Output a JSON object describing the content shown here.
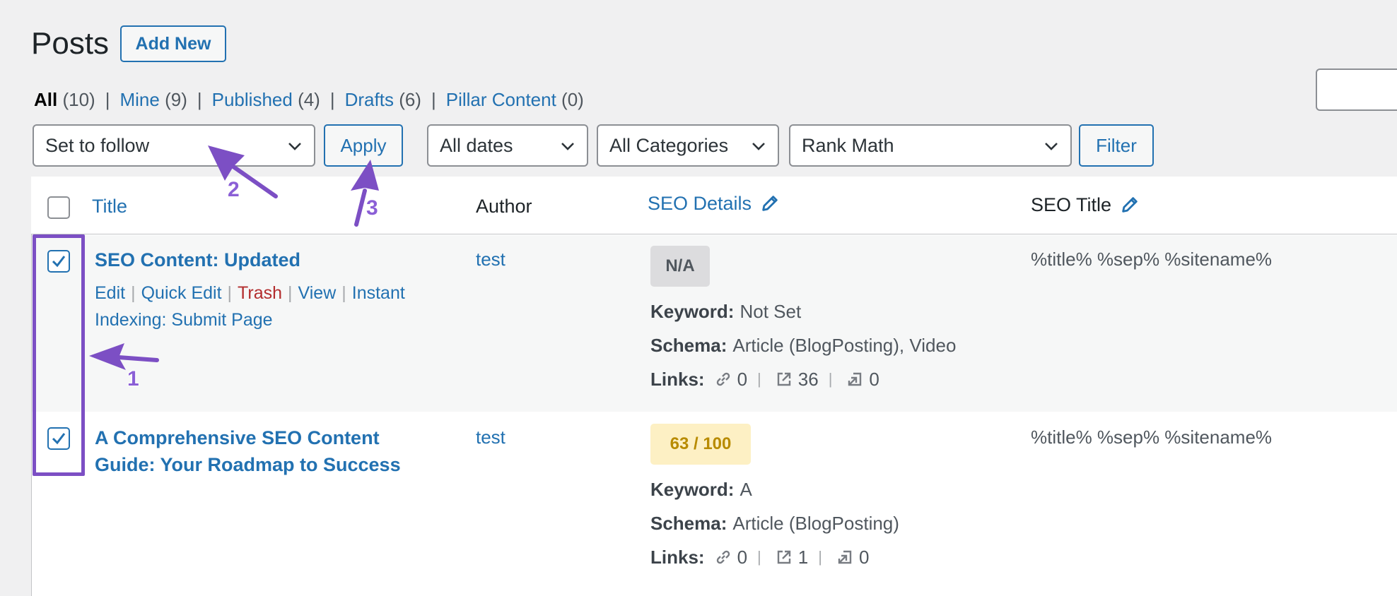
{
  "header": {
    "title": "Posts",
    "add_new_label": "Add New"
  },
  "views": {
    "all": {
      "label": "All",
      "count": "(10)"
    },
    "mine": {
      "label": "Mine",
      "count": "(9)"
    },
    "published": {
      "label": "Published",
      "count": "(4)"
    },
    "drafts": {
      "label": "Drafts",
      "count": "(6)"
    },
    "pillar": {
      "label": "Pillar Content",
      "count": "(0)"
    },
    "separator": "|"
  },
  "toolbar": {
    "bulk_action_value": "Set to follow",
    "apply_label": "Apply",
    "dates_value": "All dates",
    "categories_value": "All Categories",
    "rankmath_value": "Rank Math",
    "filter_label": "Filter"
  },
  "columns": {
    "title": "Title",
    "author": "Author",
    "seo_details": "SEO Details",
    "seo_title": "SEO Title"
  },
  "posts": [
    {
      "title": "SEO Content: Updated",
      "actions": {
        "edit": "Edit",
        "quick_edit": "Quick Edit",
        "trash": "Trash",
        "view": "View",
        "instant": "Instant",
        "indexing": "Indexing: Submit Page"
      },
      "author": "test",
      "score": "N/A",
      "keyword_label": "Keyword:",
      "keyword": "Not Set",
      "schema_label": "Schema:",
      "schema": "Article (BlogPosting), Video",
      "links_label": "Links:",
      "links_internal": "0",
      "links_external": "36",
      "links_incoming": "0",
      "seo_title": "%title% %sep% %sitename%",
      "checked": true
    },
    {
      "title_line1": "A Comprehensive SEO Content",
      "title_line2": "Guide: Your Roadmap to Success",
      "author": "test",
      "score": "63 / 100",
      "keyword_label": "Keyword:",
      "keyword": "A",
      "schema_label": "Schema:",
      "schema": "Article (BlogPosting)",
      "links_label": "Links:",
      "links_internal": "0",
      "links_external": "1",
      "links_incoming": "0",
      "seo_title": "%title% %sep% %sitename%",
      "checked": true
    }
  ],
  "annotations": {
    "step1": "1",
    "step2": "2",
    "step3": "3"
  },
  "colors": {
    "accent": "#2271b1",
    "annotation": "#7c4fc4",
    "trash": "#b32d2e",
    "score_bg": "#fdf0c4"
  }
}
